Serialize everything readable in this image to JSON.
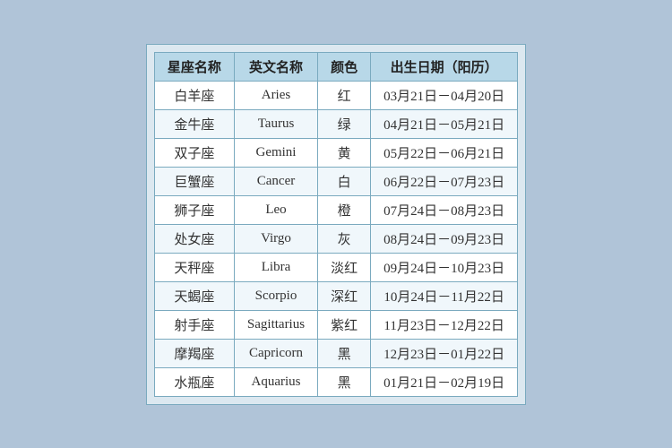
{
  "table": {
    "headers": [
      "星座名称",
      "英文名称",
      "颜色",
      "出生日期（阳历）"
    ],
    "rows": [
      [
        "白羊座",
        "Aries",
        "红",
        "03月21日－04月20日"
      ],
      [
        "金牛座",
        "Taurus",
        "绿",
        "04月21日－05月21日"
      ],
      [
        "双子座",
        "Gemini",
        "黄",
        "05月22日－06月21日"
      ],
      [
        "巨蟹座",
        "Cancer",
        "白",
        "06月22日－07月23日"
      ],
      [
        "狮子座",
        "Leo",
        "橙",
        "07月24日－08月23日"
      ],
      [
        "处女座",
        "Virgo",
        "灰",
        "08月24日－09月23日"
      ],
      [
        "天秤座",
        "Libra",
        "淡红",
        "09月24日－10月23日"
      ],
      [
        "天蝎座",
        "Scorpio",
        "深红",
        "10月24日－11月22日"
      ],
      [
        "射手座",
        "Sagittarius",
        "紫红",
        "11月23日－12月22日"
      ],
      [
        "摩羯座",
        "Capricorn",
        "黑",
        "12月23日－01月22日"
      ],
      [
        "水瓶座",
        "Aquarius",
        "黑",
        "01月21日－02月19日"
      ]
    ]
  }
}
